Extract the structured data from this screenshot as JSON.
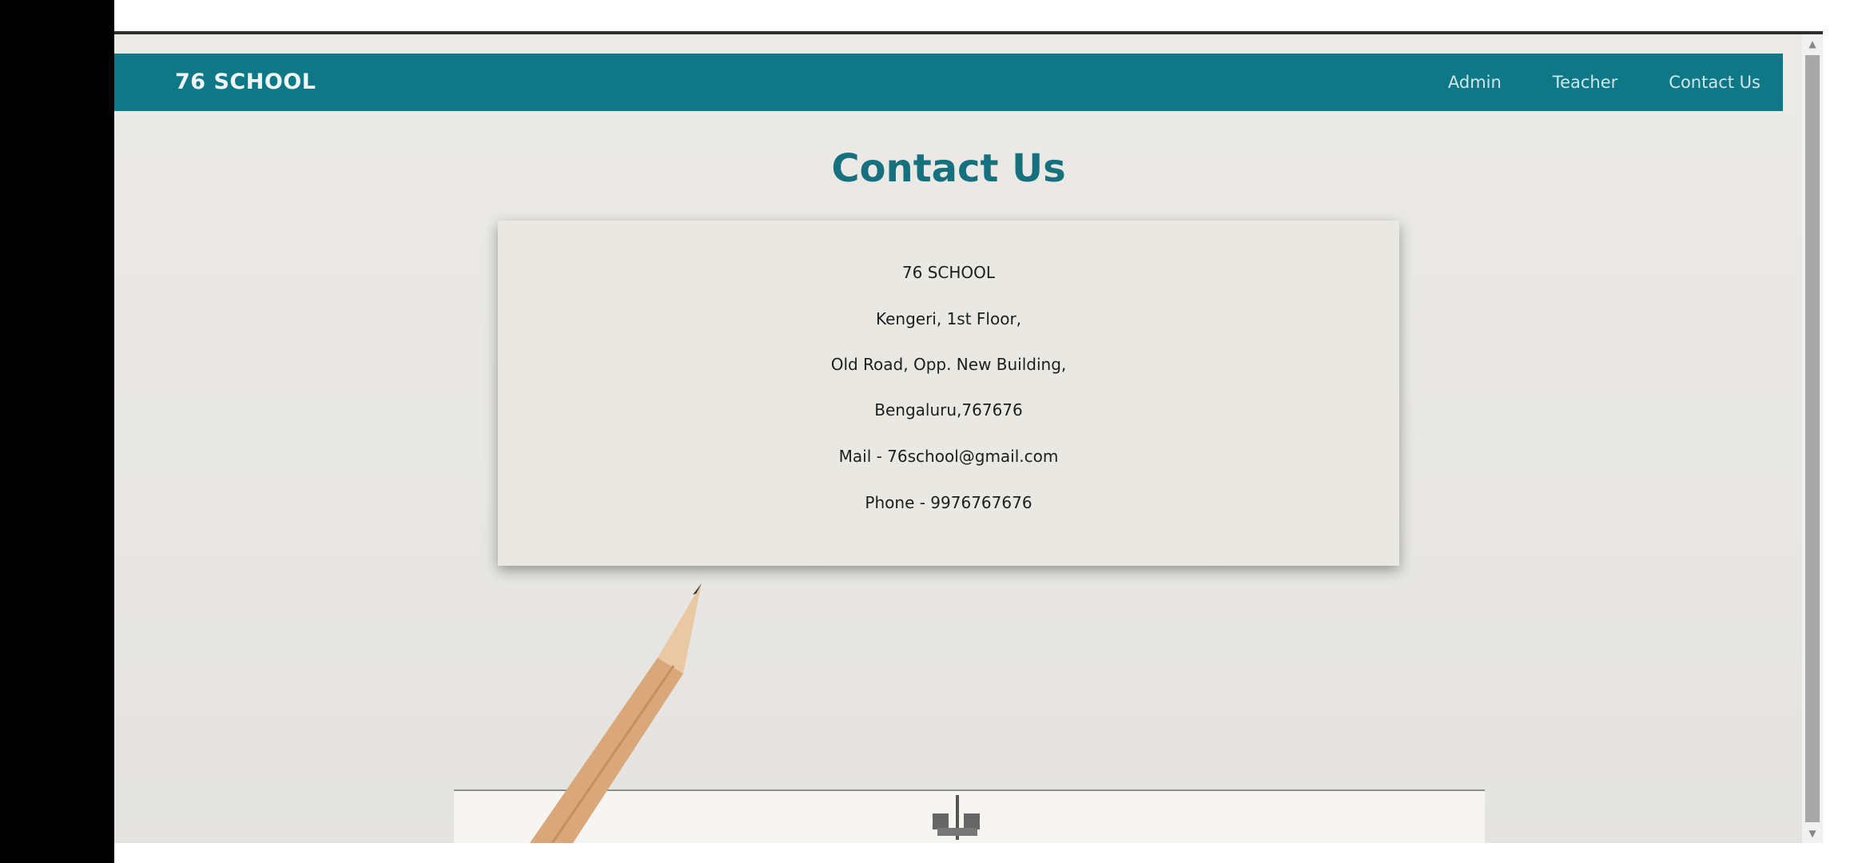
{
  "navbar": {
    "brand": "76 SCHOOL",
    "links": [
      "Admin",
      "Teacher",
      "Contact Us"
    ]
  },
  "page": {
    "title": "Contact Us"
  },
  "card": {
    "lines": [
      "76 SCHOOL",
      "Kengeri, 1st Floor,",
      "Old Road, Opp. New Building,",
      "Bengaluru,767676",
      "Mail - 76school@gmail.com",
      "Phone - 9976767676"
    ]
  },
  "colors": {
    "navbar": "#0e7886",
    "title": "#17707d",
    "background": "#e8e7e3"
  },
  "icons": {
    "scroll_up": "triangle-up",
    "scroll_down": "triangle-down"
  }
}
